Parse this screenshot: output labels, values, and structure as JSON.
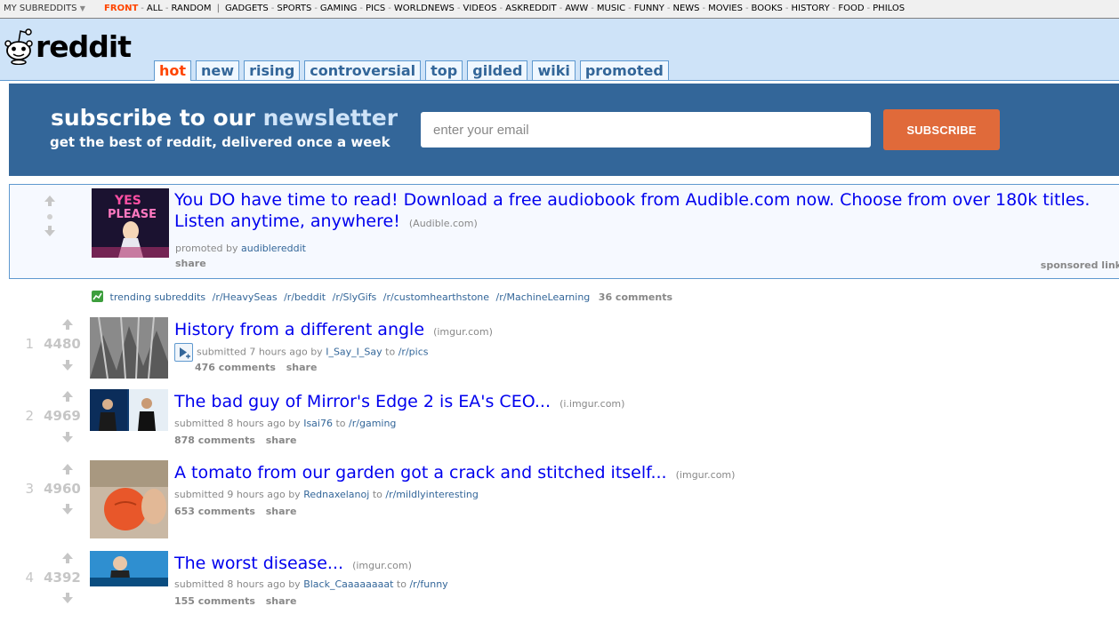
{
  "topbar": {
    "my_subreddits": "MY SUBREDDITS",
    "front": "FRONT",
    "all": "ALL",
    "random": "RANDOM",
    "subreddits": [
      "GADGETS",
      "SPORTS",
      "GAMING",
      "PICS",
      "WORLDNEWS",
      "VIDEOS",
      "ASKREDDIT",
      "AWW",
      "MUSIC",
      "FUNNY",
      "NEWS",
      "MOVIES",
      "BOOKS",
      "HISTORY",
      "FOOD",
      "PHILOS"
    ]
  },
  "header": {
    "logo_text": "reddit",
    "tabs": [
      "hot",
      "new",
      "rising",
      "controversial",
      "top",
      "gilded",
      "wiki",
      "promoted"
    ],
    "selected_tab": "hot"
  },
  "newsletter": {
    "title_part1": "subscribe to our",
    "title_part2": "newsletter",
    "subtitle": "get the best of reddit, delivered once a week",
    "email_placeholder": "enter your email",
    "button_label": "SUBSCRIBE"
  },
  "promoted": {
    "title": "You DO have time to read! Download a free audiobook from Audible.com now. Choose from over 180k titles. Listen anytime, anywhere!",
    "domain": "(Audible.com)",
    "promoted_by_label": "promoted by",
    "promoted_by_user": "audiblereddit",
    "share_label": "share",
    "sponsored_label": "sponsored link"
  },
  "trending": {
    "label": "trending subreddits",
    "subreddits": [
      "/r/HeavySeas",
      "/r/beddit",
      "/r/SlyGifs",
      "/r/customhearthstone",
      "/r/MachineLearning"
    ],
    "comments": "36 comments"
  },
  "posts": [
    {
      "rank": "1",
      "score": "4480",
      "title": "History from a different angle",
      "domain": "(imgur.com)",
      "submitted": "submitted 7 hours ago by",
      "author": "I_Say_I_Say",
      "to": "to",
      "subreddit": "/r/pics",
      "comments": "476 comments",
      "share": "share"
    },
    {
      "rank": "2",
      "score": "4969",
      "title": "The bad guy of Mirror's Edge 2 is EA's CEO...",
      "domain": "(i.imgur.com)",
      "submitted": "submitted 8 hours ago by",
      "author": "Isai76",
      "to": "to",
      "subreddit": "/r/gaming",
      "comments": "878 comments",
      "share": "share"
    },
    {
      "rank": "3",
      "score": "4960",
      "title": "A tomato from our garden got a crack and stitched itself...",
      "domain": "(imgur.com)",
      "submitted": "submitted 9 hours ago by",
      "author": "Rednaxelanoj",
      "to": "to",
      "subreddit": "/r/mildlyinteresting",
      "comments": "653 comments",
      "share": "share"
    },
    {
      "rank": "4",
      "score": "4392",
      "title": "The worst disease...",
      "domain": "(imgur.com)",
      "submitted": "submitted 8 hours ago by",
      "author": "Black_Caaaaaaaat",
      "to": "to",
      "subreddit": "/r/funny",
      "comments": "155 comments",
      "share": "share"
    }
  ],
  "colors": {
    "accent": "#ff4500",
    "header_bg": "#cee3f8",
    "newsletter_bg": "#336699",
    "subscribe_button": "#e06a3a",
    "link": "#0000ee"
  }
}
